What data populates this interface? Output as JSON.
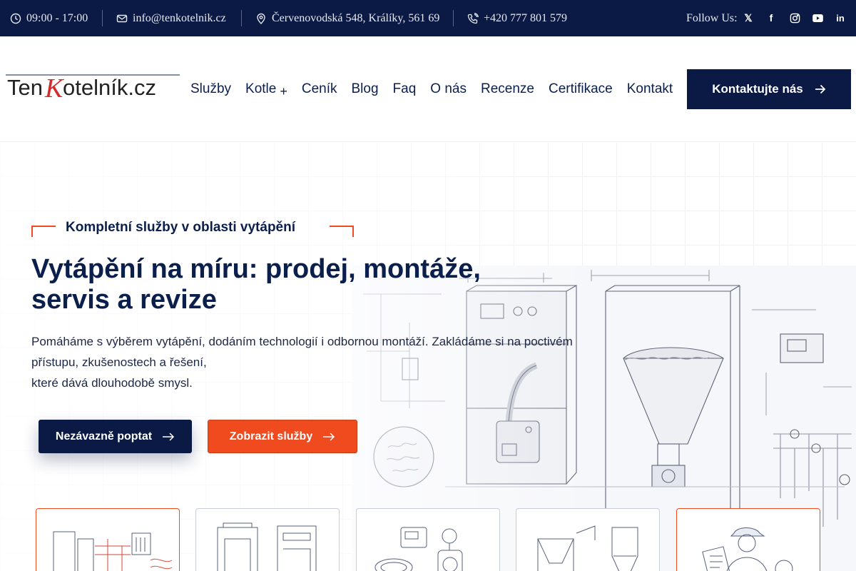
{
  "topbar": {
    "hours": "09:00 - 17:00",
    "email": "info@tenkotelnik.cz",
    "address": "Červenovodská 548, Králíky, 561 69",
    "phone": "+420 777 801 579",
    "follow_label": "Follow Us:",
    "social": [
      {
        "icon": "x-twitter-icon",
        "glyph": "𝕏"
      },
      {
        "icon": "facebook-icon",
        "glyph": "f"
      },
      {
        "icon": "instagram-icon",
        "glyph": "◎"
      },
      {
        "icon": "youtube-icon",
        "glyph": "▶"
      },
      {
        "icon": "linkedin-icon",
        "glyph": "in"
      }
    ]
  },
  "header": {
    "logo_alt": "TenKotelník.cz",
    "nav": [
      {
        "label": "Služby"
      },
      {
        "label": "Kotle",
        "has_submenu": true
      },
      {
        "label": "Ceník"
      },
      {
        "label": "Blog"
      },
      {
        "label": "Faq"
      },
      {
        "label": "O nás"
      },
      {
        "label": "Recenze"
      },
      {
        "label": "Certifikace"
      },
      {
        "label": "Kontakt"
      }
    ],
    "submenu_symbol": "+",
    "cta_label": "Kontaktujte nás"
  },
  "hero": {
    "eyebrow": "Kompletní služby v oblasti vytápění",
    "title_line1": "Vytápění na míru: prodej, montáže,",
    "title_line2": "servis a revize",
    "text_line1": "Pomáháme s výběrem vytápění, dodáním technologií i odbornou montáží. Zakládáme si na poctivém",
    "text_line2": "přístupu, zkušenostech a řešení,",
    "text_line3": "které dává dlouhodobě smysl.",
    "btn_primary": "Nezávazně poptat",
    "btn_secondary": "Zobrazit služby"
  },
  "colors": {
    "navy": "#0b1a44",
    "accent": "#f04a1f",
    "text": "#0b1f4d"
  },
  "cards": [
    {
      "icon": "heating-system-sketch-icon",
      "highlighted": true
    },
    {
      "icon": "boilers-sketch-icon",
      "highlighted": false
    },
    {
      "icon": "controls-pump-sketch-icon",
      "highlighted": false
    },
    {
      "icon": "pellet-hopper-sketch-icon",
      "highlighted": false
    },
    {
      "icon": "technician-sketch-icon",
      "highlighted": true
    }
  ]
}
